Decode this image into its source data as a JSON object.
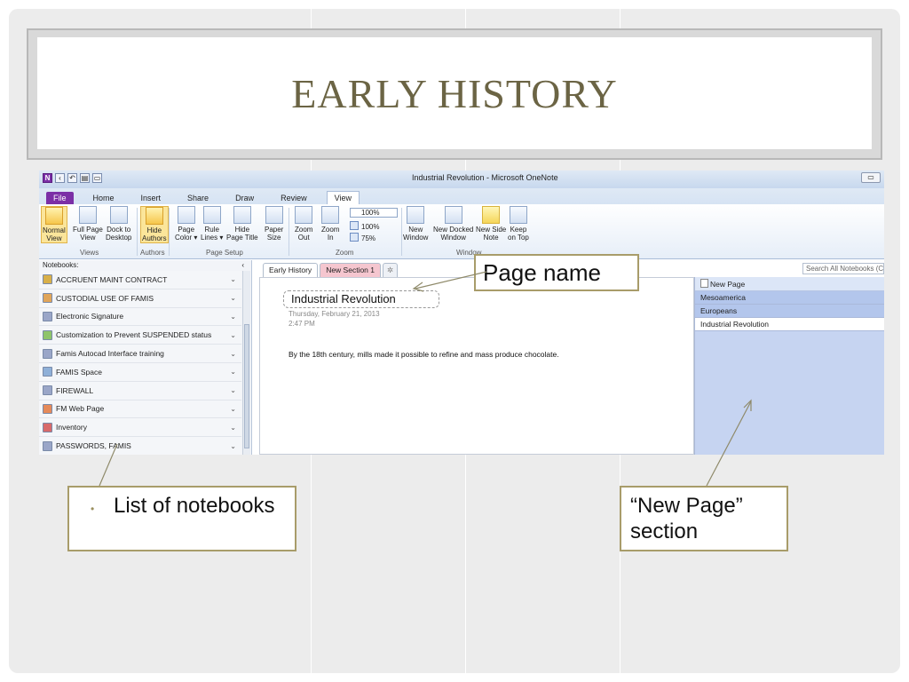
{
  "slide": {
    "title": "EARLY HISTORY"
  },
  "app": {
    "window_title": "Industrial Revolution  -  Microsoft OneNote",
    "logo": "N",
    "qat": [
      "back",
      "undo",
      "layout",
      "page"
    ]
  },
  "tabs": [
    {
      "label": "File"
    },
    {
      "label": "Home"
    },
    {
      "label": "Insert"
    },
    {
      "label": "Share"
    },
    {
      "label": "Draw"
    },
    {
      "label": "Review"
    },
    {
      "label": "View"
    }
  ],
  "ribbon": {
    "views": {
      "label": "Views",
      "buttons": [
        {
          "label": "Normal\nView"
        },
        {
          "label": "Full Page\nView"
        },
        {
          "label": "Dock to\nDesktop"
        }
      ]
    },
    "authors": {
      "label": "Authors",
      "buttons": [
        {
          "label": "Hide\nAuthors"
        }
      ]
    },
    "page_setup": {
      "label": "Page Setup",
      "buttons": [
        {
          "label": "Page\nColor ▾"
        },
        {
          "label": "Rule\nLines ▾"
        },
        {
          "label": "Hide\nPage Title"
        },
        {
          "label": "Paper\nSize"
        }
      ]
    },
    "zoom": {
      "label": "Zoom",
      "buttons": [
        {
          "label": "Zoom\nOut"
        },
        {
          "label": "Zoom\nIn"
        }
      ],
      "combo_value": "100%",
      "items": [
        "100%",
        "75%"
      ]
    },
    "window": {
      "label": "Window",
      "buttons": [
        {
          "label": "New\nWindow"
        },
        {
          "label": "New Docked\nWindow"
        },
        {
          "label": "New Side\nNote"
        },
        {
          "label": "Keep\non Top"
        }
      ]
    }
  },
  "navigation": {
    "header": "Notebooks:",
    "collapse": "‹",
    "notebooks": [
      {
        "name": "ACCRUENT MAINT CONTRACT",
        "color": "#d8b04a"
      },
      {
        "name": "CUSTODIAL USE OF FAMIS",
        "color": "#e0a55a"
      },
      {
        "name": "Electronic Signature",
        "color": "#9aa6c8"
      },
      {
        "name": "Customization to Prevent SUSPENDED status",
        "color": "#8fc46a"
      },
      {
        "name": "Famis Autocad Interface training",
        "color": "#9aa6c8"
      },
      {
        "name": "FAMIS Space",
        "color": "#8fb0d8"
      },
      {
        "name": "FIREWALL",
        "color": "#9aa6c8"
      },
      {
        "name": "FM Web Page",
        "color": "#e58a5a"
      },
      {
        "name": "Inventory",
        "color": "#d86a6a"
      },
      {
        "name": "PASSWORDS, FAMIS",
        "color": "#9aa6c8"
      }
    ]
  },
  "sections": [
    {
      "label": "Early History"
    },
    {
      "label": "New Section 1"
    },
    {
      "label": "✲"
    }
  ],
  "search": {
    "placeholder": "Search All Notebooks (Ct"
  },
  "page": {
    "title": "Industrial Revolution",
    "date": "Thursday, February 21, 2013",
    "time": "2:47 PM",
    "body": "By the 18th century, mills made it possible to refine and mass produce chocolate."
  },
  "pages_pane": {
    "new_page": "New Page",
    "pages": [
      {
        "label": "Mesoamerica",
        "state": "sub"
      },
      {
        "label": "Europeans",
        "state": "sub"
      },
      {
        "label": "Industrial Revolution",
        "state": "selected"
      }
    ]
  },
  "callouts": {
    "page_name": "Page name",
    "notebooks": "List of notebooks",
    "bullet": "•",
    "new_page": "“New Page” section"
  },
  "colors": {
    "title": "#6b6444",
    "callout_border": "#a89c6a",
    "file_tab": "#7b2fa6",
    "pages_pane": "#c6d4f1"
  }
}
